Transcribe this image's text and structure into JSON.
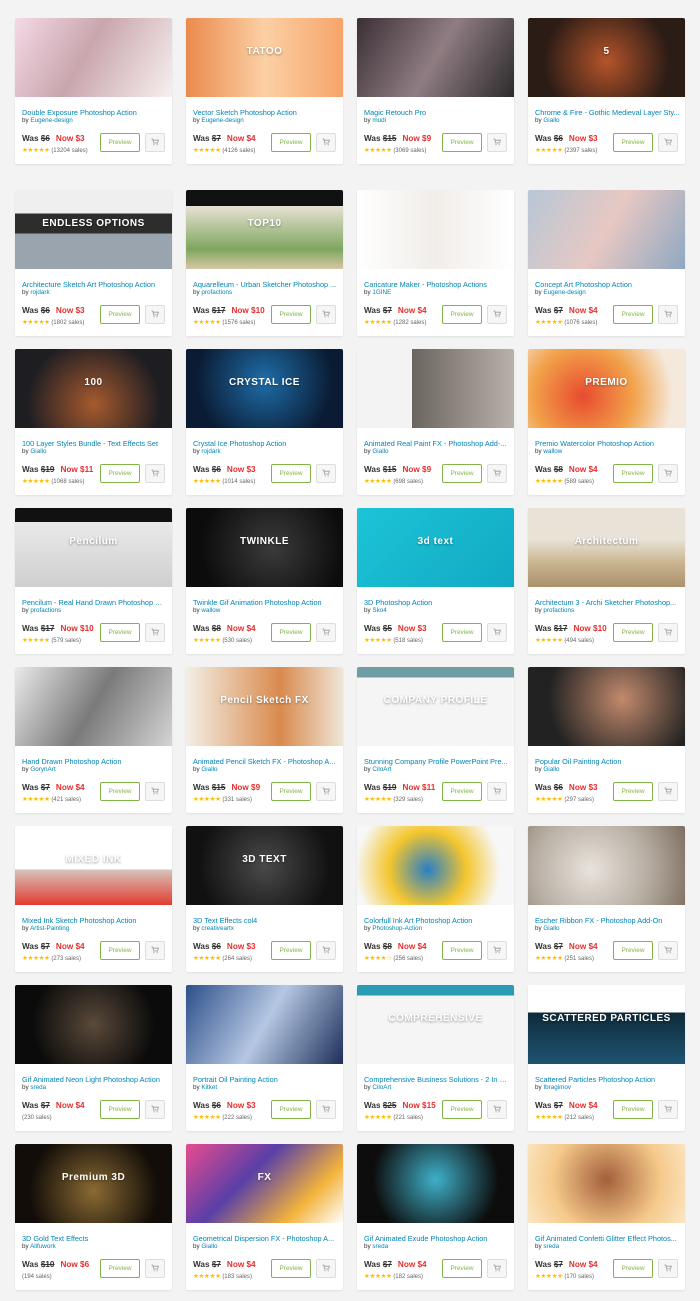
{
  "labels": {
    "was": "Was ",
    "now": "Now ",
    "by": "by ",
    "preview": "Preview",
    "sales_suffix": " sales"
  },
  "colors": {
    "accent_link": "#0084b4",
    "price_now": "#e62e2d",
    "button_green": "#82b548",
    "star": "#ffbb00",
    "page_bg": "#f3f3f3"
  },
  "items": [
    {
      "title": "Double Exposure Photoshop Action",
      "author": "Eugene-design",
      "was": "$6",
      "now": "$3",
      "stars": 4.5,
      "sales": "13204",
      "thumb_bg": "linear-gradient(120deg,#f4d9e6,#c9a6ad 45%,#f7f0ee)",
      "thumb_text": ""
    },
    {
      "title": "Vector Sketch Photoshop Action",
      "author": "Eugene-design",
      "was": "$7",
      "now": "$4",
      "stars": 5,
      "sales": "4126",
      "thumb_bg": "linear-gradient(90deg,#ea8a4d,#fbd0a4 50%,#f6a46a)",
      "thumb_text": "TATOO"
    },
    {
      "title": "Magic Retouch Pro",
      "author": "mudi",
      "was": "$15",
      "now": "$9",
      "stars": 4.5,
      "sales": "3069",
      "thumb_bg": "linear-gradient(120deg,#3a2f35,#8f7d82 50%,#2c2a2c)",
      "thumb_text": ""
    },
    {
      "title": "Chrome & Fire - Gothic Medieval Layer Sty...",
      "author": "Giallo",
      "was": "$6",
      "now": "$3",
      "stars": 4.5,
      "sales": "2397",
      "thumb_bg": "radial-gradient(circle at 50% 55%,#b5542a,#2b1c16 70%)",
      "thumb_text": "5"
    },
    {
      "title": "Architecture Sketch Art Photoshop Action",
      "author": "rojdark",
      "was": "$6",
      "now": "$3",
      "stars": 5,
      "sales": "1802",
      "thumb_bg": "linear-gradient(180deg,#efefef 30%,#2d2d2d 30%,#2d2d2d 55%,#9aa4ae 55%)",
      "thumb_text": "ENDLESS OPTIONS"
    },
    {
      "title": "Aquarelleum - Urban Sketcher Photoshop ...",
      "author": "profactions",
      "was": "$17",
      "now": "$10",
      "stars": 5,
      "sales": "1576",
      "thumb_bg": "linear-gradient(180deg,#111 0,#111 20%,#e8e2d4 20%,#7ea65f 75%,#d7c7a6)",
      "thumb_text": "TOP10"
    },
    {
      "title": "Caricature Maker - Photoshop Actions",
      "author": "1GINE",
      "was": "$7",
      "now": "$4",
      "stars": 5,
      "sales": "1282",
      "thumb_bg": "linear-gradient(90deg,#ffffff,#f1ede9 50%,#ffffff)",
      "thumb_text": ""
    },
    {
      "title": "Concept Art Photoshop Action",
      "author": "Eugene-design",
      "was": "$7",
      "now": "$4",
      "stars": 5,
      "sales": "1076",
      "thumb_bg": "linear-gradient(120deg,#b7c7d6,#e7c8c3 50%,#8fa8c2)",
      "thumb_text": ""
    },
    {
      "title": "100 Layer Styles Bundle - Text Effects Set",
      "author": "Giallo",
      "was": "$19",
      "now": "$11",
      "stars": 5,
      "sales": "1068",
      "thumb_bg": "radial-gradient(circle at 50% 70%,#a65a2e,#1e1d22 70%)",
      "thumb_text": "100"
    },
    {
      "title": "Crystal Ice Photoshop Action",
      "author": "rojdark",
      "was": "$6",
      "now": "$3",
      "stars": 5,
      "sales": "1014",
      "thumb_bg": "radial-gradient(circle at 50% 40%,#1f6da8,#0a1b33 75%)",
      "thumb_text": "CRYSTAL ICE"
    },
    {
      "title": "Animated Real Paint FX - Photoshop Add-...",
      "author": "Giallo",
      "was": "$15",
      "now": "$9",
      "stars": 5,
      "sales": "698",
      "thumb_bg": "linear-gradient(90deg,#f3f3f3 35%,#6b655f 35%,#b8b2aa)",
      "thumb_text": ""
    },
    {
      "title": "Premio Watercolor Photoshop Action",
      "author": "wallow",
      "was": "$8",
      "now": "$4",
      "stars": 5,
      "sales": "589",
      "thumb_bg": "radial-gradient(circle at 35% 60%,#e84b2f,#f2a24a 45%,#f5e9dc 80%)",
      "thumb_text": "PREMIO"
    },
    {
      "title": "Pencilum - Real Hand Drawn Photoshop Pl...",
      "author": "profactions",
      "was": "$17",
      "now": "$10",
      "stars": 5,
      "sales": "579",
      "thumb_bg": "linear-gradient(180deg,#111 0,#111 18%,#e9e9e9 18%,#cfcfcf)",
      "thumb_text": "Pencilum"
    },
    {
      "title": "Twinkle Gif Animation Photoshop Action",
      "author": "wallow",
      "was": "$8",
      "now": "$4",
      "stars": 5,
      "sales": "530",
      "thumb_bg": "radial-gradient(circle at 55% 50%,#3b3b3b,#0c0c0c 75%)",
      "thumb_text": "TWINKLE"
    },
    {
      "title": "3D Photoshop Action",
      "author": "Sko4",
      "was": "$5",
      "now": "$3",
      "stars": 5,
      "sales": "518",
      "thumb_bg": "linear-gradient(135deg,#1cc4d6,#12a9c4)",
      "thumb_text": "3d text"
    },
    {
      "title": "Architectum 3 - Archi Sketcher Photoshop...",
      "author": "profactions",
      "was": "$17",
      "now": "$10",
      "stars": 5,
      "sales": "494",
      "thumb_bg": "linear-gradient(180deg,#e8e3d6 40%,#c9b48e 70%,#a9916c)",
      "thumb_text": "Architectum"
    },
    {
      "title": "Hand Drawn Photoshop Action",
      "author": "GorynArt",
      "was": "$7",
      "now": "$4",
      "stars": 5,
      "sales": "421",
      "thumb_bg": "linear-gradient(120deg,#eaeaea,#7a7a7a 50%,#d4d4d4)",
      "thumb_text": ""
    },
    {
      "title": "Animated Pencil Sketch FX - Photoshop A...",
      "author": "Giallo",
      "was": "$15",
      "now": "$9",
      "stars": 5,
      "sales": "331",
      "thumb_bg": "linear-gradient(90deg,#f3efe6,#d98a4d 60%,#efe6d8)",
      "thumb_text": "Pencil Sketch FX"
    },
    {
      "title": "Stunning Company Profile PowerPoint Pre...",
      "author": "CiloArt",
      "was": "$19",
      "now": "$11",
      "stars": 5,
      "sales": "329",
      "thumb_bg": "linear-gradient(180deg,#6e9ea4 0,#6e9ea4 13%,#f5f5f5 13%)",
      "thumb_text": "COMPANY PROFILE"
    },
    {
      "title": "Popular Oil Painting Action",
      "author": "Giallo",
      "was": "$6",
      "now": "$3",
      "stars": 5,
      "sales": "297",
      "thumb_bg": "radial-gradient(circle at 60% 40%,#c28a6d,#222 70%)",
      "thumb_text": ""
    },
    {
      "title": "Mixed Ink Sketch Photoshop Action",
      "author": "Artist-Painting",
      "was": "$7",
      "now": "$4",
      "stars": 4.5,
      "sales": "273",
      "thumb_bg": "linear-gradient(180deg,#ffffff 55%,#d6c4bb 55%,#e23b30)",
      "thumb_text": "MIXED INK"
    },
    {
      "title": "3D Text Effects col4",
      "author": "creativeartx",
      "was": "$6",
      "now": "$3",
      "stars": 5,
      "sales": "264",
      "thumb_bg": "radial-gradient(circle at 50% 50%,#4a4a4a,#111 75%)",
      "thumb_text": "3D TEXT"
    },
    {
      "title": "Colorfull Ink Art Photoshop Action",
      "author": "Photoshop-Action",
      "was": "$8",
      "now": "$4",
      "stars": 3.5,
      "sales": "256",
      "thumb_bg": "radial-gradient(circle at 45% 55%,#2a7fc4,#f4c62e 40%,#f7f7f7 75%)",
      "thumb_text": ""
    },
    {
      "title": "Escher Ribbon FX - Photoshop Add-On",
      "author": "Giallo",
      "was": "$7",
      "now": "$4",
      "stars": 5,
      "sales": "251",
      "thumb_bg": "radial-gradient(circle at 40% 55%,#e8e3dc,#b7aea3 55%,#7d6f60)",
      "thumb_text": ""
    },
    {
      "title": "Gif Animated Neon Light Photoshop Action",
      "author": "sreda",
      "was": "$7",
      "now": "$4",
      "stars": 0,
      "sales": "230",
      "thumb_bg": "radial-gradient(circle at 50% 50%,#5a4a3a,#0b0b0b 70%)",
      "thumb_text": ""
    },
    {
      "title": "Portrait Oil Painting Action",
      "author": "Kitket",
      "was": "$6",
      "now": "$3",
      "stars": 5,
      "sales": "222",
      "thumb_bg": "linear-gradient(120deg,#2c4f8a,#b5c7e2 50%,#1d2f5a)",
      "thumb_text": ""
    },
    {
      "title": "Comprehensive Business Solutions - 2 In 1...",
      "author": "CiloArt",
      "was": "$25",
      "now": "$15",
      "stars": 5,
      "sales": "221",
      "thumb_bg": "linear-gradient(180deg,#2a9bb5 0,#2a9bb5 13%,#f5f5f5 13%)",
      "thumb_text": "COMPREHENSIVE"
    },
    {
      "title": "Scattered Particles Photoshop Action",
      "author": "Ibragimov",
      "was": "$7",
      "now": "$4",
      "stars": 4.5,
      "sales": "212",
      "thumb_bg": "linear-gradient(180deg,#ffffff 35%,#0f2a3a 35%,#1e5470)",
      "thumb_text": "SCATTERED PARTICLES"
    },
    {
      "title": "3D Gold Text Effects",
      "author": "Alifuwork",
      "was": "$10",
      "now": "$6",
      "stars": 0,
      "sales": "194",
      "thumb_bg": "radial-gradient(circle at 50% 60%,#8a6a33,#120d08 70%)",
      "thumb_text": "Premium 3D"
    },
    {
      "title": "Geometrical Dispersion FX - Photoshop A...",
      "author": "Giallo",
      "was": "$7",
      "now": "$4",
      "stars": 5,
      "sales": "183",
      "thumb_bg": "linear-gradient(135deg,#e94b8f,#5a3fa7 40%,#f2b33c 75%,#ffffff)",
      "thumb_text": "FX"
    },
    {
      "title": "Gif Animated Exude Photoshop Action",
      "author": "sreda",
      "was": "$7",
      "now": "$4",
      "stars": 5,
      "sales": "182",
      "thumb_bg": "radial-gradient(circle at 50% 45%,#3fb0c9,#0d0d0d 70%)",
      "thumb_text": ""
    },
    {
      "title": "Gif Animated Confetti Glitter Effect Photos...",
      "author": "sreda",
      "was": "$7",
      "now": "$4",
      "stars": 5,
      "sales": "170",
      "thumb_bg": "radial-gradient(circle at 50% 45%,#a35f3a,#f5c98a 60%,#fbe7c4)",
      "thumb_text": ""
    }
  ]
}
